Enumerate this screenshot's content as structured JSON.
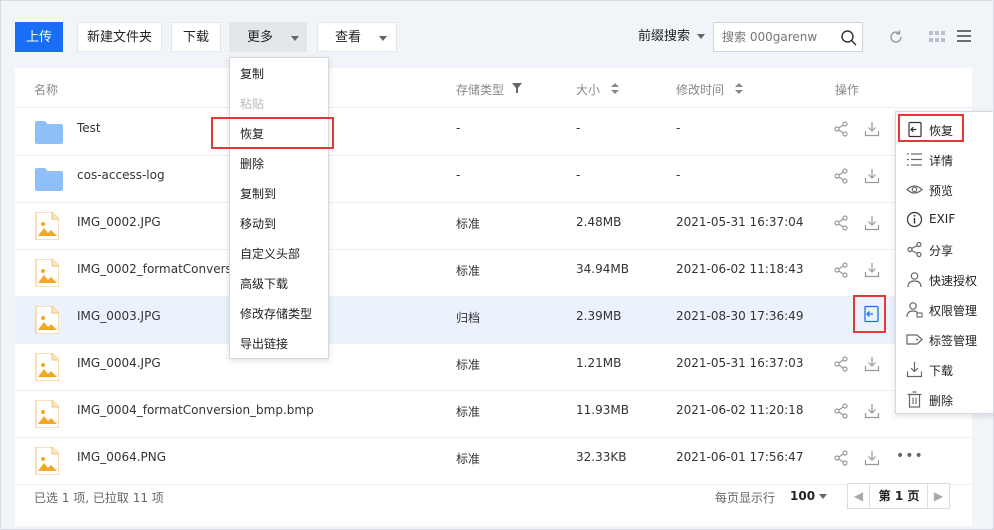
{
  "toolbar": {
    "upload": "上传",
    "new_folder": "新建文件夹",
    "download": "下载",
    "more": "更多",
    "view": "查看",
    "prefix_search": "前缀搜索",
    "search_placeholder": "搜索 000garenw"
  },
  "table": {
    "headers": {
      "name": "名称",
      "storage_type": "存储类型",
      "size": "大小",
      "modified": "修改时间",
      "actions": "操作"
    },
    "rows": [
      {
        "name": "Test",
        "type": "-",
        "size": "-",
        "time": "-",
        "kind": "folder"
      },
      {
        "name": "cos-access-log",
        "type": "-",
        "size": "-",
        "time": "-",
        "kind": "folder"
      },
      {
        "name": "IMG_0002.JPG",
        "type": "标准",
        "size": "2.48MB",
        "time": "2021-05-31 16:37:04",
        "kind": "image"
      },
      {
        "name": "IMG_0002_formatConversio",
        "type": "标准",
        "size": "34.94MB",
        "time": "2021-06-02 11:18:43",
        "kind": "image"
      },
      {
        "name": "IMG_0003.JPG",
        "type": "归档",
        "size": "2.39MB",
        "time": "2021-08-30 17:36:49",
        "kind": "image",
        "selected": true
      },
      {
        "name": "IMG_0004.JPG",
        "type": "标准",
        "size": "1.21MB",
        "time": "2021-05-31 16:37:03",
        "kind": "image"
      },
      {
        "name": "IMG_0004_formatConversion_bmp.bmp",
        "type": "标准",
        "size": "11.93MB",
        "time": "2021-06-02 11:20:18",
        "kind": "image"
      },
      {
        "name": "IMG_0064.PNG",
        "type": "标准",
        "size": "32.33KB",
        "time": "2021-06-01 17:56:47",
        "kind": "image"
      }
    ]
  },
  "more_menu": {
    "items": [
      "复制",
      "粘贴",
      "恢复",
      "删除",
      "复制到",
      "移动到",
      "自定义头部",
      "高级下载",
      "修改存储类型",
      "导出链接"
    ],
    "highlighted": "恢复"
  },
  "context_menu": {
    "items": [
      {
        "label": "恢复",
        "icon": "restore-icon"
      },
      {
        "label": "详情",
        "icon": "list-icon"
      },
      {
        "label": "预览",
        "icon": "eye-icon"
      },
      {
        "label": "EXIF",
        "icon": "info-icon"
      },
      {
        "label": "分享",
        "icon": "share-icon"
      },
      {
        "label": "快速授权",
        "icon": "user-icon"
      },
      {
        "label": "权限管理",
        "icon": "user-lock-icon"
      },
      {
        "label": "标签管理",
        "icon": "tag-icon"
      },
      {
        "label": "下载",
        "icon": "download-icon"
      },
      {
        "label": "删除",
        "icon": "trash-icon"
      }
    ]
  },
  "footer": {
    "selection_status": "已选 1 项, 已拉取 11 项",
    "page_size_label": "每页显示行",
    "page_size": "100",
    "current_page": "第 1 页"
  },
  "colors": {
    "primary": "#1a6ef5",
    "highlight_box": "#e53935",
    "selected_row": "#ecf2fc"
  }
}
